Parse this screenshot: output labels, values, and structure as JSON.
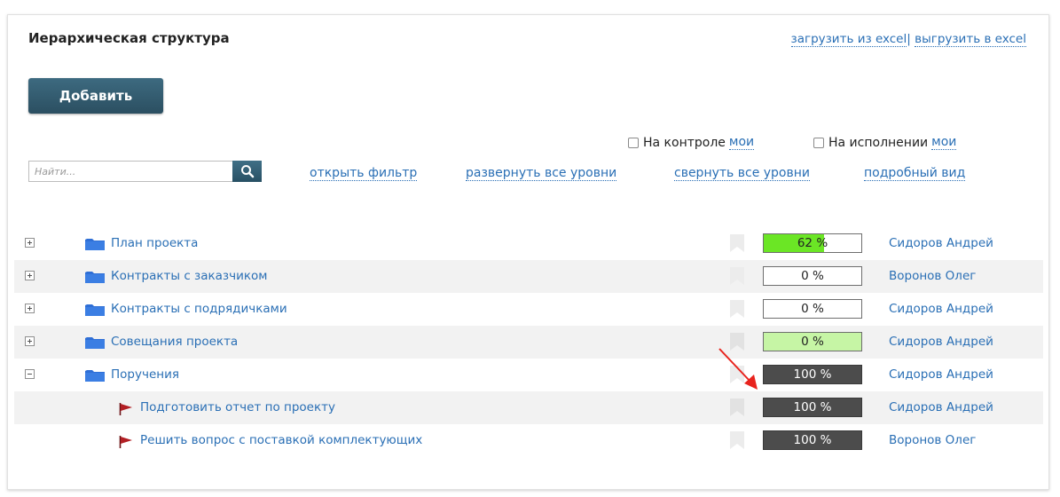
{
  "header": {
    "title": "Иерархическая структура",
    "import_link": "загрузить из excel",
    "separator": "|",
    "export_link": "выгрузить в excel"
  },
  "toolbar": {
    "add_label": "Добавить"
  },
  "checks": {
    "control_label": "На контроле",
    "control_mine": "мои",
    "execution_label": "На исполнении",
    "execution_mine": "мои"
  },
  "search": {
    "placeholder": "Найти...",
    "icon": "search-icon"
  },
  "filters": {
    "open_filter": "открыть фильтр",
    "expand_all": "развернуть все уровни",
    "collapse_all": "свернуть все уровни",
    "detailed_view": "подробный вид"
  },
  "colors": {
    "link": "#2a6fb5",
    "progress_green": "#6be625",
    "progress_light": "#c6f5a5",
    "progress_dark": "#4c4c4c",
    "folder": "#2f6fd6",
    "flag": "#b21f24"
  },
  "tree": [
    {
      "name": "План проекта",
      "type": "folder",
      "expanded": false,
      "progress": 62,
      "progress_text": "62 %",
      "style": "partial",
      "person": "Сидоров Андрей"
    },
    {
      "name": "Контракты с заказчиком",
      "type": "folder",
      "expanded": false,
      "progress": 0,
      "progress_text": "0 %",
      "style": "empty",
      "person": "Воронов Олег"
    },
    {
      "name": "Контракты с подрядичками",
      "type": "folder",
      "expanded": false,
      "progress": 0,
      "progress_text": "0 %",
      "style": "empty",
      "person": "Сидоров Андрей"
    },
    {
      "name": "Совещания проекта",
      "type": "folder",
      "expanded": false,
      "progress": 0,
      "progress_text": "0 %",
      "style": "light",
      "person": "Сидоров Андрей"
    },
    {
      "name": "Поручения",
      "type": "folder",
      "expanded": true,
      "progress": 100,
      "progress_text": "100 %",
      "style": "dark",
      "person": "Сидоров Андрей"
    },
    {
      "name": "Подготовить отчет по проекту",
      "type": "task",
      "progress": 100,
      "progress_text": "100 %",
      "style": "dark",
      "person": "Сидоров Андрей"
    },
    {
      "name": "Решить вопрос с поставкой комплектующих",
      "type": "task",
      "progress": 100,
      "progress_text": "100 %",
      "style": "dark",
      "person": "Воронов Олег"
    }
  ]
}
